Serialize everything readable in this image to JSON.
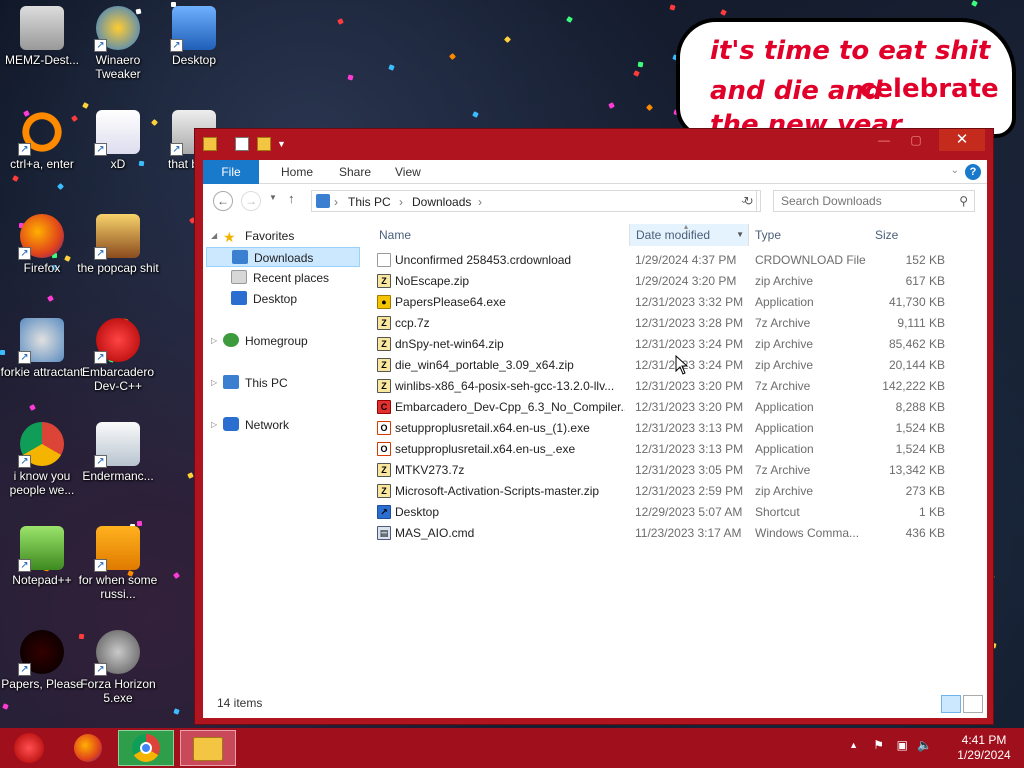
{
  "desktop": {
    "icons": [
      {
        "label": "MEMZ-Dest...",
        "icon": "recycle-bin-icon"
      },
      {
        "label": "Winaero Tweaker",
        "icon": "winaero-icon"
      },
      {
        "label": "Desktop",
        "icon": "desktop-icon"
      },
      {
        "label": "ctrl+a, enter",
        "icon": "orange-ring-icon"
      },
      {
        "label": "xD",
        "icon": "hxd-icon"
      },
      {
        "label": "that bu its",
        "icon": "windows-icon"
      },
      {
        "label": "Firefox",
        "icon": "firefox-icon"
      },
      {
        "label": "the popcap shit",
        "icon": "popcap-icon"
      },
      {
        "label": "forkie attractant",
        "icon": "settings-icon"
      },
      {
        "label": "Embarcadero Dev-C++",
        "icon": "devcpp-icon"
      },
      {
        "label": "i know you people we...",
        "icon": "chrome-icon"
      },
      {
        "label": "Endermanc...",
        "icon": "app-window-icon"
      },
      {
        "label": "Notepad++",
        "icon": "notepadpp-icon"
      },
      {
        "label": "for when some russi...",
        "icon": "de-icon"
      },
      {
        "label": "Papers, Please",
        "icon": "papers-please-icon"
      },
      {
        "label": "Forza Horizon 5.exe",
        "icon": "flash-icon"
      }
    ]
  },
  "bubble": {
    "line1": "it's time to eat shit",
    "line2": "and die and",
    "line3": "celebrate",
    "line4": "the new year"
  },
  "window": {
    "close": "✕",
    "ribbon_tabs": [
      "File",
      "Home",
      "Share",
      "View"
    ],
    "address": {
      "segments": [
        "This PC",
        "Downloads"
      ]
    },
    "search_placeholder": "Search Downloads",
    "nav": {
      "favorites": "Favorites",
      "downloads": "Downloads",
      "recent": "Recent places",
      "desktop": "Desktop",
      "homegroup": "Homegroup",
      "thispc": "This PC",
      "network": "Network"
    },
    "columns": {
      "name": "Name",
      "date": "Date modified",
      "type": "Type",
      "size": "Size"
    },
    "files": [
      {
        "name": "Unconfirmed 258453.crdownload",
        "date": "1/29/2024 4:37 PM",
        "type": "CRDOWNLOAD File",
        "size": "152 KB",
        "icon": "file"
      },
      {
        "name": "NoEscape.zip",
        "date": "1/29/2024 3:20 PM",
        "type": "zip Archive",
        "size": "617 KB",
        "icon": "zip"
      },
      {
        "name": "PapersPlease64.exe",
        "date": "12/31/2023 3:32 PM",
        "type": "Application",
        "size": "41,730 KB",
        "icon": "exe"
      },
      {
        "name": "ccp.7z",
        "date": "12/31/2023 3:28 PM",
        "type": "7z Archive",
        "size": "9,111 KB",
        "icon": "zip"
      },
      {
        "name": "dnSpy-net-win64.zip",
        "date": "12/31/2023 3:24 PM",
        "type": "zip Archive",
        "size": "85,462 KB",
        "icon": "zip"
      },
      {
        "name": "die_win64_portable_3.09_x64.zip",
        "date": "12/31/2023 3:24 PM",
        "type": "zip Archive",
        "size": "20,144 KB",
        "icon": "zip"
      },
      {
        "name": "winlibs-x86_64-posix-seh-gcc-13.2.0-llv...",
        "date": "12/31/2023 3:20 PM",
        "type": "7z Archive",
        "size": "142,222 KB",
        "icon": "zip"
      },
      {
        "name": "Embarcadero_Dev-Cpp_6.3_No_Compiler...",
        "date": "12/31/2023 3:20 PM",
        "type": "Application",
        "size": "8,288 KB",
        "icon": "devcpp"
      },
      {
        "name": "setupproplusretail.x64.en-us_(1).exe",
        "date": "12/31/2023 3:13 PM",
        "type": "Application",
        "size": "1,524 KB",
        "icon": "office"
      },
      {
        "name": "setupproplusretail.x64.en-us_.exe",
        "date": "12/31/2023 3:13 PM",
        "type": "Application",
        "size": "1,524 KB",
        "icon": "office"
      },
      {
        "name": "MTKV273.7z",
        "date": "12/31/2023 3:05 PM",
        "type": "7z Archive",
        "size": "13,342 KB",
        "icon": "zip"
      },
      {
        "name": "Microsoft-Activation-Scripts-master.zip",
        "date": "12/31/2023 2:59 PM",
        "type": "zip Archive",
        "size": "273 KB",
        "icon": "zip"
      },
      {
        "name": "Desktop",
        "date": "12/29/2023 5:07 AM",
        "type": "Shortcut",
        "size": "1 KB",
        "icon": "shortcut"
      },
      {
        "name": "MAS_AIO.cmd",
        "date": "11/23/2023 3:17 AM",
        "type": "Windows Comma...",
        "size": "436 KB",
        "icon": "cmd"
      }
    ],
    "status": "14 items"
  },
  "taskbar": {
    "time": "4:41 PM",
    "date": "1/29/2024"
  },
  "colors": {
    "accent": "#1979ca",
    "frame": "#b0141f",
    "taskbar": "#a00f1c",
    "bubble_text": "#e0002a"
  }
}
